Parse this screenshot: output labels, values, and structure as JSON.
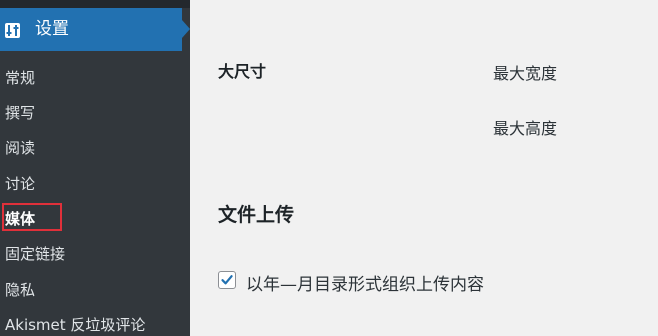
{
  "sidebar": {
    "active_menu": {
      "label": "设置",
      "icon": "settings-sliders-icon"
    },
    "items": [
      {
        "label": "常规"
      },
      {
        "label": "撰写"
      },
      {
        "label": "阅读"
      },
      {
        "label": "讨论"
      },
      {
        "label": "媒体",
        "current": true
      },
      {
        "label": "固定链接"
      },
      {
        "label": "隐私"
      },
      {
        "label": "Akismet 反垃圾评论"
      }
    ]
  },
  "main": {
    "large_size": {
      "label": "大尺寸",
      "max_width_label": "最大宽度",
      "max_height_label": "最大高度"
    },
    "uploads": {
      "title": "文件上传",
      "organize_checkbox_label": "以年—月目录形式组织上传内容",
      "organize_checked": true
    }
  },
  "colors": {
    "sidebar_bg": "#32373c",
    "accent": "#2271b1",
    "highlight_border": "#e0303a",
    "content_bg": "#f1f1f1"
  }
}
